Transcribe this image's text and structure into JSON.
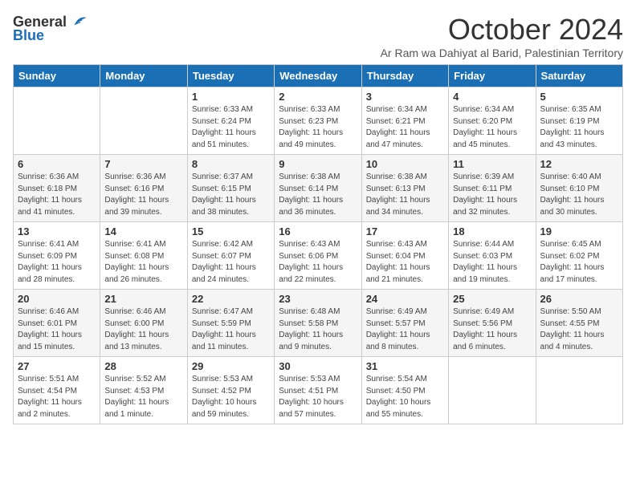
{
  "header": {
    "logo_general": "General",
    "logo_blue": "Blue",
    "month_title": "October 2024",
    "subtitle": "Ar Ram wa Dahiyat al Barid, Palestinian Territory"
  },
  "days_of_week": [
    "Sunday",
    "Monday",
    "Tuesday",
    "Wednesday",
    "Thursday",
    "Friday",
    "Saturday"
  ],
  "weeks": [
    [
      {
        "day": "",
        "info": ""
      },
      {
        "day": "",
        "info": ""
      },
      {
        "day": "1",
        "info": "Sunrise: 6:33 AM\nSunset: 6:24 PM\nDaylight: 11 hours and 51 minutes."
      },
      {
        "day": "2",
        "info": "Sunrise: 6:33 AM\nSunset: 6:23 PM\nDaylight: 11 hours and 49 minutes."
      },
      {
        "day": "3",
        "info": "Sunrise: 6:34 AM\nSunset: 6:21 PM\nDaylight: 11 hours and 47 minutes."
      },
      {
        "day": "4",
        "info": "Sunrise: 6:34 AM\nSunset: 6:20 PM\nDaylight: 11 hours and 45 minutes."
      },
      {
        "day": "5",
        "info": "Sunrise: 6:35 AM\nSunset: 6:19 PM\nDaylight: 11 hours and 43 minutes."
      }
    ],
    [
      {
        "day": "6",
        "info": "Sunrise: 6:36 AM\nSunset: 6:18 PM\nDaylight: 11 hours and 41 minutes."
      },
      {
        "day": "7",
        "info": "Sunrise: 6:36 AM\nSunset: 6:16 PM\nDaylight: 11 hours and 39 minutes."
      },
      {
        "day": "8",
        "info": "Sunrise: 6:37 AM\nSunset: 6:15 PM\nDaylight: 11 hours and 38 minutes."
      },
      {
        "day": "9",
        "info": "Sunrise: 6:38 AM\nSunset: 6:14 PM\nDaylight: 11 hours and 36 minutes."
      },
      {
        "day": "10",
        "info": "Sunrise: 6:38 AM\nSunset: 6:13 PM\nDaylight: 11 hours and 34 minutes."
      },
      {
        "day": "11",
        "info": "Sunrise: 6:39 AM\nSunset: 6:11 PM\nDaylight: 11 hours and 32 minutes."
      },
      {
        "day": "12",
        "info": "Sunrise: 6:40 AM\nSunset: 6:10 PM\nDaylight: 11 hours and 30 minutes."
      }
    ],
    [
      {
        "day": "13",
        "info": "Sunrise: 6:41 AM\nSunset: 6:09 PM\nDaylight: 11 hours and 28 minutes."
      },
      {
        "day": "14",
        "info": "Sunrise: 6:41 AM\nSunset: 6:08 PM\nDaylight: 11 hours and 26 minutes."
      },
      {
        "day": "15",
        "info": "Sunrise: 6:42 AM\nSunset: 6:07 PM\nDaylight: 11 hours and 24 minutes."
      },
      {
        "day": "16",
        "info": "Sunrise: 6:43 AM\nSunset: 6:06 PM\nDaylight: 11 hours and 22 minutes."
      },
      {
        "day": "17",
        "info": "Sunrise: 6:43 AM\nSunset: 6:04 PM\nDaylight: 11 hours and 21 minutes."
      },
      {
        "day": "18",
        "info": "Sunrise: 6:44 AM\nSunset: 6:03 PM\nDaylight: 11 hours and 19 minutes."
      },
      {
        "day": "19",
        "info": "Sunrise: 6:45 AM\nSunset: 6:02 PM\nDaylight: 11 hours and 17 minutes."
      }
    ],
    [
      {
        "day": "20",
        "info": "Sunrise: 6:46 AM\nSunset: 6:01 PM\nDaylight: 11 hours and 15 minutes."
      },
      {
        "day": "21",
        "info": "Sunrise: 6:46 AM\nSunset: 6:00 PM\nDaylight: 11 hours and 13 minutes."
      },
      {
        "day": "22",
        "info": "Sunrise: 6:47 AM\nSunset: 5:59 PM\nDaylight: 11 hours and 11 minutes."
      },
      {
        "day": "23",
        "info": "Sunrise: 6:48 AM\nSunset: 5:58 PM\nDaylight: 11 hours and 9 minutes."
      },
      {
        "day": "24",
        "info": "Sunrise: 6:49 AM\nSunset: 5:57 PM\nDaylight: 11 hours and 8 minutes."
      },
      {
        "day": "25",
        "info": "Sunrise: 6:49 AM\nSunset: 5:56 PM\nDaylight: 11 hours and 6 minutes."
      },
      {
        "day": "26",
        "info": "Sunrise: 5:50 AM\nSunset: 4:55 PM\nDaylight: 11 hours and 4 minutes."
      }
    ],
    [
      {
        "day": "27",
        "info": "Sunrise: 5:51 AM\nSunset: 4:54 PM\nDaylight: 11 hours and 2 minutes."
      },
      {
        "day": "28",
        "info": "Sunrise: 5:52 AM\nSunset: 4:53 PM\nDaylight: 11 hours and 1 minute."
      },
      {
        "day": "29",
        "info": "Sunrise: 5:53 AM\nSunset: 4:52 PM\nDaylight: 10 hours and 59 minutes."
      },
      {
        "day": "30",
        "info": "Sunrise: 5:53 AM\nSunset: 4:51 PM\nDaylight: 10 hours and 57 minutes."
      },
      {
        "day": "31",
        "info": "Sunrise: 5:54 AM\nSunset: 4:50 PM\nDaylight: 10 hours and 55 minutes."
      },
      {
        "day": "",
        "info": ""
      },
      {
        "day": "",
        "info": ""
      }
    ]
  ]
}
